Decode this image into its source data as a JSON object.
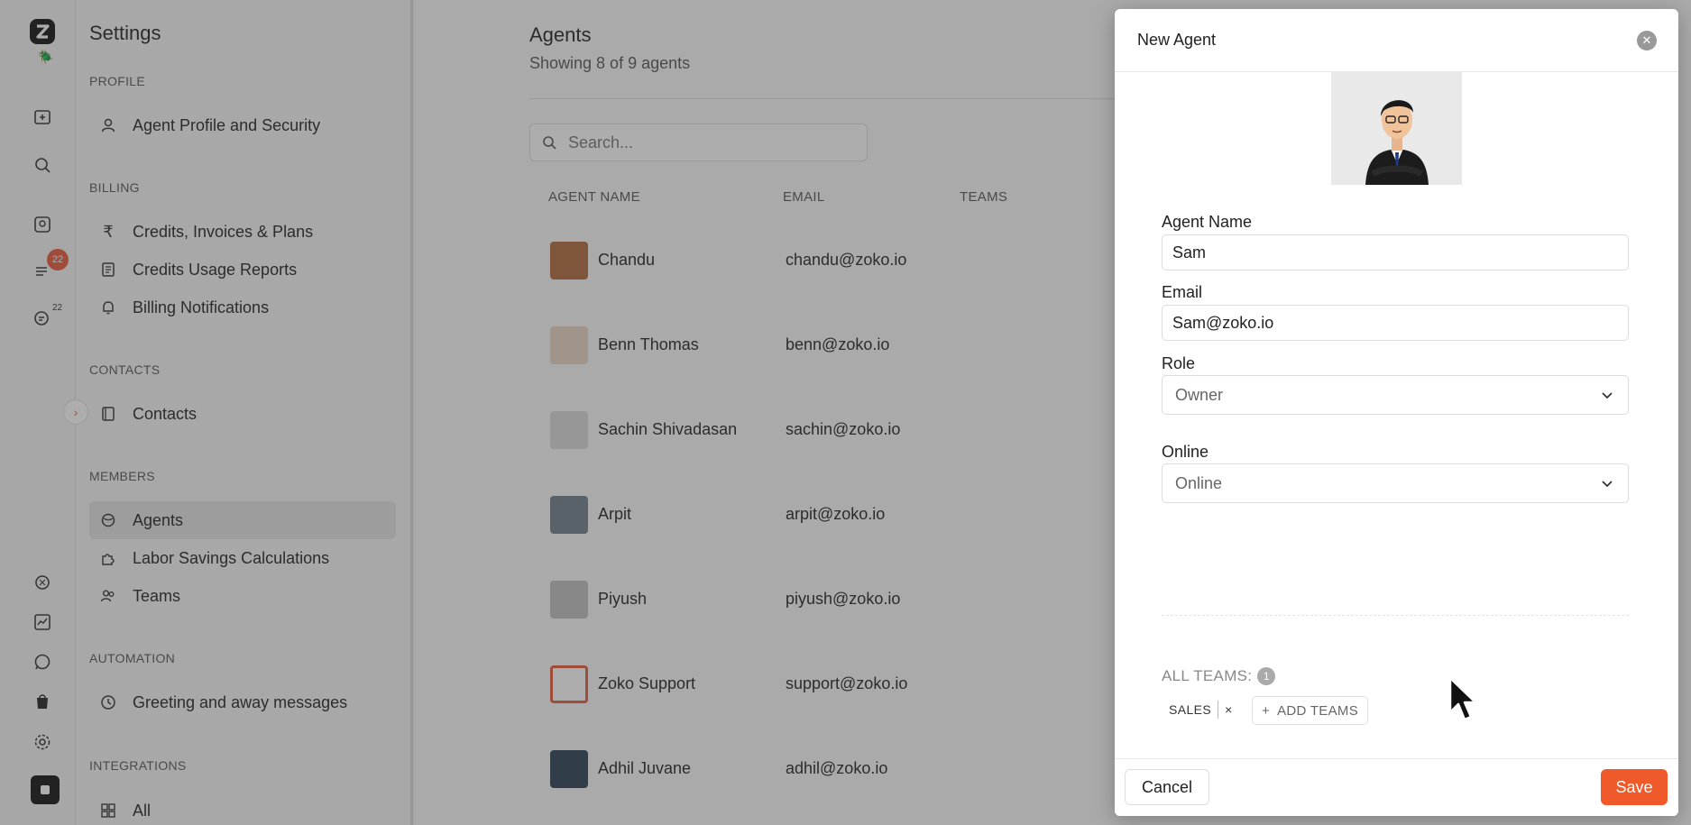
{
  "rail": {
    "icons": [
      "app-logo-icon",
      "bug-icon",
      "new-chat-icon",
      "search-icon",
      "contacts-card-icon",
      "list-icon",
      "chat-count-icon",
      "openai-icon",
      "analytics-icon",
      "whatsapp-icon",
      "shopify-icon",
      "settings-gear-icon",
      "profile-square-icon"
    ],
    "badge_count": "22",
    "chat_count": "22"
  },
  "settings": {
    "title": "Settings",
    "sections": {
      "profile": "PROFILE",
      "billing": "BILLING",
      "contacts": "CONTACTS",
      "members": "MEMBERS",
      "automation": "AUTOMATION",
      "integrations": "INTEGRATIONS"
    },
    "items": {
      "agent_profile": "Agent Profile and Security",
      "credits_invoices": "Credits, Invoices & Plans",
      "credits_usage": "Credits Usage Reports",
      "billing_notifications": "Billing Notifications",
      "contacts": "Contacts",
      "agents": "Agents",
      "labor_savings": "Labor Savings Calculations",
      "teams": "Teams",
      "greeting": "Greeting and away messages",
      "all": "All"
    }
  },
  "main": {
    "title": "Agents",
    "subtitle": "Showing 8 of 9 agents",
    "search_placeholder": "Search...",
    "columns": [
      "AGENT NAME",
      "EMAIL",
      "TEAMS"
    ],
    "agents": [
      {
        "name": "Chandu",
        "email": "chandu@zoko.io",
        "avatar_color": "#b06a3b"
      },
      {
        "name": "Benn Thomas",
        "email": "benn@zoko.io",
        "avatar_color": "#e8d5c4"
      },
      {
        "name": "Sachin Shivadasan",
        "email": "sachin@zoko.io",
        "avatar_color": "#d9d9d9"
      },
      {
        "name": "Arpit",
        "email": "arpit@zoko.io",
        "avatar_color": "#6f7d8a"
      },
      {
        "name": "Piyush",
        "email": "piyush@zoko.io",
        "avatar_color": "#bfbfbf"
      },
      {
        "name": "Zoko Support",
        "email": "support@zoko.io",
        "avatar_color": "#e8593b"
      },
      {
        "name": "Adhil Juvane",
        "email": "adhil@zoko.io",
        "avatar_color": "#2b3f55"
      }
    ]
  },
  "modal": {
    "title": "New Agent",
    "agent_name_label": "Agent Name",
    "agent_name_value": "Sam",
    "email_label": "Email",
    "email_value": "Sam@zoko.io",
    "role_label": "Role",
    "role_value": "Owner",
    "online_label": "Online",
    "online_value": "Online",
    "all_teams_label": "ALL TEAMS:",
    "all_teams_count": "1",
    "team_tag": "SALES",
    "team_tag_remove": "×",
    "add_teams_label": "ADD TEAMS",
    "cancel_label": "Cancel",
    "save_label": "Save"
  },
  "colors": {
    "accent": "#f05a2a",
    "badge": "#e8593b",
    "overlay": "rgba(60,60,60,0.42)"
  }
}
